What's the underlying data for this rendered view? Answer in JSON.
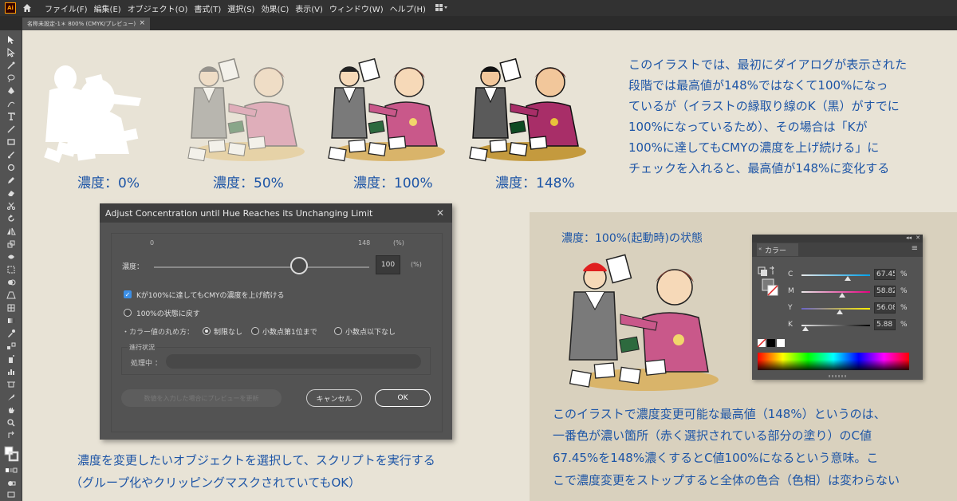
{
  "menubar": {
    "items": [
      "ファイル(F)",
      "編集(E)",
      "オブジェクト(O)",
      "書式(T)",
      "選択(S)",
      "効果(C)",
      "表示(V)",
      "ウィンドウ(W)",
      "ヘルプ(H)"
    ],
    "logo_text": "Ai"
  },
  "document_tab": {
    "title": "名称未設定-1＊ 800% (CMYK/プレビュー)",
    "close": "×"
  },
  "concentration_labels": [
    "濃度：0%",
    "濃度：50%",
    "濃度：100%",
    "濃度：148%"
  ],
  "top_explanation": [
    "このイラストでは、最初にダイアログが表示された",
    "段階では最高値が148%ではなくて100%になっ",
    "ているが（イラストの縁取り線のK（黒）がすでに",
    "100%になっているため）、その場合は「Kが",
    "100%に達してもCMYの濃度を上げ続ける」に",
    "チェックを入れると、最高値が148%に変化する"
  ],
  "dialog": {
    "title": "Adjust Concentration until Hue Reaches its Unchanging Limit",
    "close": "✕",
    "slider_min": "0",
    "slider_max": "148",
    "slider_max_unit": "(%)",
    "concentration_label": "濃度：",
    "value": "100",
    "value_unit": "(%)",
    "slider_fraction": 0.6757,
    "checkbox_label": "Kが100%に達してもCMYの濃度を上げ続ける",
    "checkbox_checked": true,
    "reset_radio_label": "100%の状態に戻す",
    "rounding_label": "・カラー値の丸め方：",
    "rounding_options": [
      "制限なし",
      "小数点第1位まで",
      "小数点以下なし"
    ],
    "rounding_selected": 0,
    "progress_group_label": "進行状況",
    "processing_label": "処理中 ：",
    "preview_button": "数値を入力した場合にプレビューを更新",
    "cancel_button": "キャンセル",
    "ok_button": "OK"
  },
  "bottom_left_text": [
    "濃度を変更したいオブジェクトを選択して、スクリプトを実行する",
    "（グループ化やクリッピングマスクされていてもOK）"
  ],
  "right_panel": {
    "state_label": "濃度：100%(起動時)の状態",
    "color_panel": {
      "tab_label": "カラー",
      "collapse": "◂◂",
      "close": "✕",
      "menu": "≡",
      "rows": [
        {
          "letter": "C",
          "value": "67.45",
          "unit": "%",
          "fraction": 0.6745,
          "color": "#00a0e9"
        },
        {
          "letter": "M",
          "value": "58.82",
          "unit": "%",
          "fraction": 0.5882,
          "color": "#e4007f"
        },
        {
          "letter": "Y",
          "value": "56.08",
          "unit": "%",
          "fraction": 0.5608,
          "color": "#fff100"
        },
        {
          "letter": "K",
          "value": "5.88",
          "unit": "%",
          "fraction": 0.0588,
          "color": "#000000"
        }
      ]
    },
    "explanation": [
      "このイラストで濃度変更可能な最高値（148%）というのは、",
      "一番色が濃い箇所（赤く選択されている部分の塗り）のC値",
      "67.45%を148%濃くするとC値100%になるという意味。こ",
      "こで濃度変更をストップすると全体の色合（色相）は変わらない"
    ]
  },
  "colors": {
    "text_blue": "#1d55a6",
    "canvas": "#e8e3d6",
    "panel_bg": "#d9d1be",
    "ui_dark": "#535353"
  }
}
